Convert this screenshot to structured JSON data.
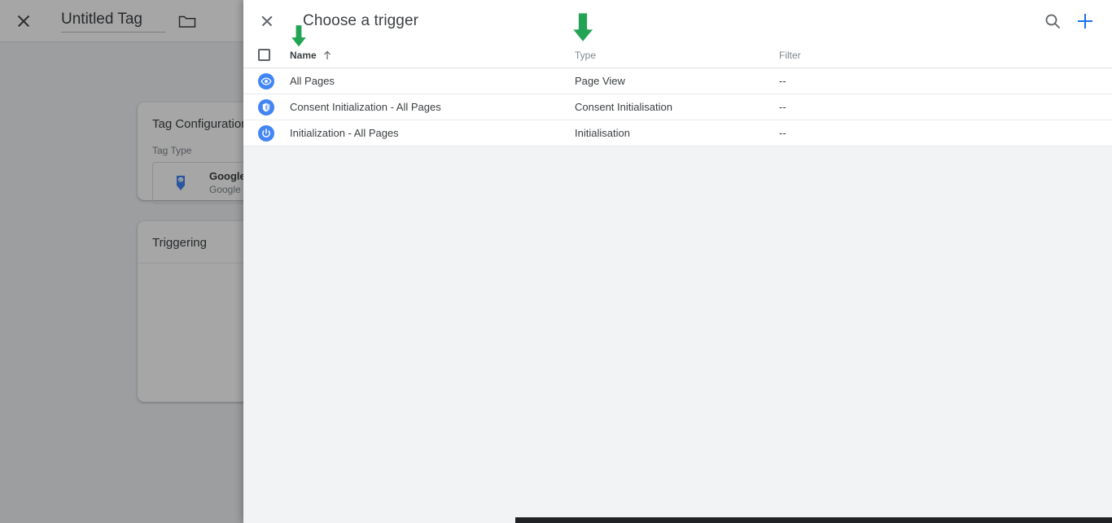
{
  "background_editor": {
    "close_icon": "close-icon",
    "tag_title": "Untitled Tag",
    "folder_icon": "folder-icon",
    "tag_configuration": {
      "card_title": "Tag Configuration",
      "field_label": "Tag Type",
      "tag_icon": "google-tag-icon",
      "tag_name": "Google Tag",
      "tag_vendor": "Google"
    },
    "triggering": {
      "card_title": "Triggering"
    }
  },
  "modal": {
    "close_icon": "close-icon",
    "title": "Choose a trigger",
    "search_icon": "search-icon",
    "add_icon": "plus-icon",
    "table": {
      "select_all_checkbox": "checkbox",
      "columns": {
        "name": "Name",
        "sort_indicator": "arrow-up-icon",
        "type": "Type",
        "filter": "Filter"
      },
      "rows": [
        {
          "icon": "eye-icon",
          "name": "All Pages",
          "type": "Page View",
          "filter": "--"
        },
        {
          "icon": "shield-icon",
          "name": "Consent Initialization - All Pages",
          "type": "Consent Initialisation",
          "filter": "--"
        },
        {
          "icon": "power-icon",
          "name": "Initialization - All Pages",
          "type": "Initialisation",
          "filter": "--"
        }
      ]
    }
  },
  "annotations": {
    "arrow_name": "green-down-arrow",
    "arrow_type": "green-down-arrow",
    "arrow_color": "#23a455"
  },
  "colors": {
    "accent_blue": "#1a73e8",
    "panel_bg": "#f1f3f4",
    "row_border": "#e8eaed",
    "text_primary": "#3c4043",
    "text_secondary": "#80868b",
    "annotation_green": "#23a455"
  }
}
